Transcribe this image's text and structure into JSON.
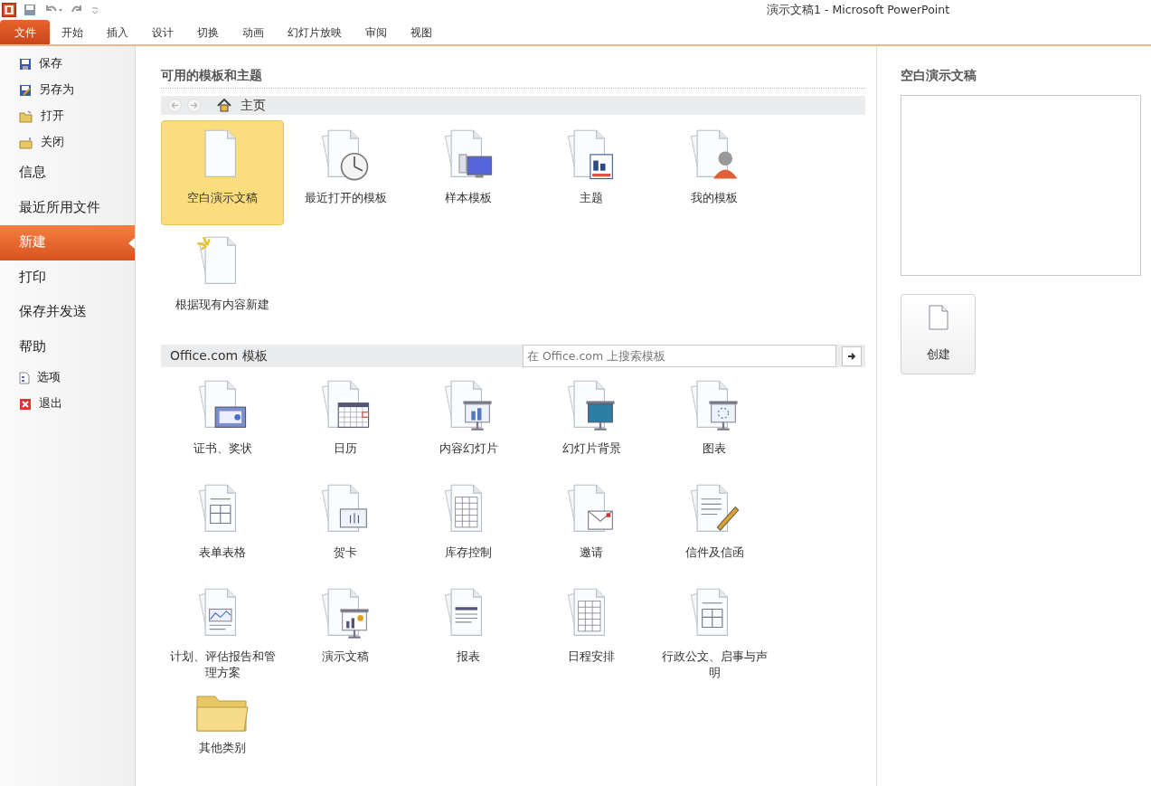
{
  "window": {
    "title": "演示文稿1 - Microsoft PowerPoint"
  },
  "ribbon_tabs": [
    {
      "label": "文件",
      "selected": true
    },
    {
      "label": "开始",
      "selected": false
    },
    {
      "label": "插入",
      "selected": false
    },
    {
      "label": "设计",
      "selected": false
    },
    {
      "label": "切换",
      "selected": false
    },
    {
      "label": "动画",
      "selected": false
    },
    {
      "label": "幻灯片放映",
      "selected": false
    },
    {
      "label": "审阅",
      "selected": false
    },
    {
      "label": "视图",
      "selected": false
    }
  ],
  "sidebar": {
    "items": [
      {
        "kind": "save",
        "label": "保存",
        "selected": false
      },
      {
        "kind": "saveas",
        "label": "另存为",
        "selected": false
      },
      {
        "kind": "open",
        "label": "打开",
        "selected": false
      },
      {
        "kind": "close",
        "label": "关闭",
        "selected": false
      },
      {
        "kind": "section",
        "label": "信息",
        "selected": false
      },
      {
        "kind": "section",
        "label": "最近所用文件",
        "selected": false
      },
      {
        "kind": "section",
        "label": "新建",
        "selected": true
      },
      {
        "kind": "section",
        "label": "打印",
        "selected": false
      },
      {
        "kind": "section",
        "label": "保存并发送",
        "selected": false
      },
      {
        "kind": "section",
        "label": "帮助",
        "selected": false
      },
      {
        "kind": "options",
        "label": "选项",
        "selected": false
      },
      {
        "kind": "exit",
        "label": "退出",
        "selected": false
      }
    ]
  },
  "available": {
    "heading": "可用的模板和主题",
    "breadcrumb": "主页",
    "tiles": [
      {
        "kind": "blank",
        "label": "空白演示文稿",
        "selected": true
      },
      {
        "kind": "clock",
        "label": "最近打开的模板",
        "selected": false
      },
      {
        "kind": "monitor",
        "label": "样本模板",
        "selected": false
      },
      {
        "kind": "theme",
        "label": "主题",
        "selected": false
      },
      {
        "kind": "person",
        "label": "我的模板",
        "selected": false
      },
      {
        "kind": "spark",
        "label": "根据现有内容新建",
        "selected": false
      }
    ]
  },
  "office": {
    "heading": "Office.com 模板",
    "search": {
      "placeholder": "在 Office.com 上搜索模板"
    },
    "tiles": [
      {
        "kind": "certificate",
        "label": "证书、奖状",
        "selected": false
      },
      {
        "kind": "calendar",
        "label": "日历",
        "selected": false
      },
      {
        "kind": "easel-bars",
        "label": "内容幻灯片",
        "selected": false
      },
      {
        "kind": "easel-wave",
        "label": "幻灯片背景",
        "selected": false
      },
      {
        "kind": "easel-dots",
        "label": "图表",
        "selected": false
      },
      {
        "kind": "form",
        "label": "表单表格",
        "selected": false
      },
      {
        "kind": "card",
        "label": "贺卡",
        "selected": false
      },
      {
        "kind": "sheet",
        "label": "库存控制",
        "selected": false
      },
      {
        "kind": "envelope",
        "label": "邀请",
        "selected": false
      },
      {
        "kind": "pencil",
        "label": "信件及信函",
        "selected": false
      },
      {
        "kind": "plan",
        "label": "计划、评估报告和管理方案",
        "selected": false
      },
      {
        "kind": "easel-chart",
        "label": "演示文稿",
        "selected": false
      },
      {
        "kind": "report",
        "label": "报表",
        "selected": false
      },
      {
        "kind": "sheet",
        "label": "日程安排",
        "selected": false
      },
      {
        "kind": "form",
        "label": "行政公文、启事与声明",
        "selected": false
      },
      {
        "kind": "folder",
        "label": "其他类别",
        "selected": false
      }
    ]
  },
  "preview": {
    "heading": "空白演示文稿",
    "create_button": "创建"
  }
}
